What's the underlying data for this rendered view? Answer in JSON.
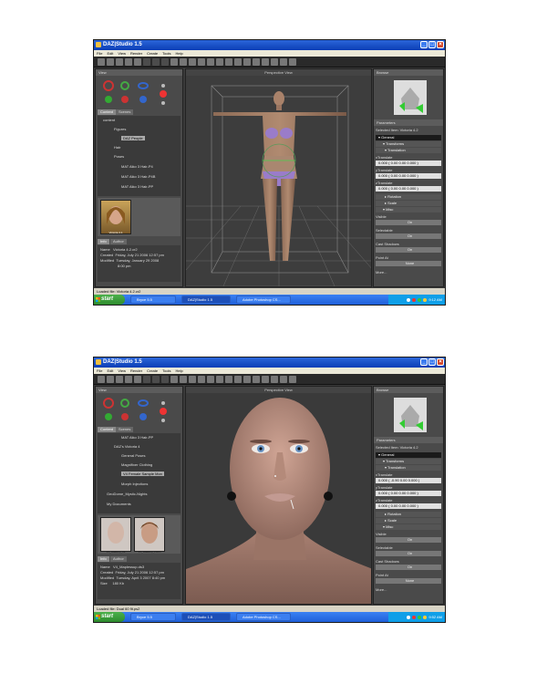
{
  "shot1": {
    "window_title": "DAZ|Studio 1.5",
    "menu": [
      "File",
      "Edit",
      "View",
      "Render",
      "Create",
      "Tools",
      "Help"
    ],
    "view_panel_title": "View",
    "content_tabs": [
      "Content",
      "Scenes"
    ],
    "tree": [
      "content",
      "Figures",
      "DAZ People",
      "Hair",
      "Poses",
      "MAT Aiko 3 Hair-P4",
      "MAT Aiko 3 Hair-P4B",
      "MAT Aiko 3 Hair-PP"
    ],
    "tree_selected_index": 2,
    "thumb_label": "Victoria 4.1",
    "info_tabs": [
      "Info",
      "Author"
    ],
    "info_rows": [
      [
        "Name",
        "Victoria 4.2.cr2"
      ],
      [
        "Created",
        "Friday, July 21 2006 12:57 pm"
      ],
      [
        "Modified",
        "Tuesday, January 29 2008"
      ],
      [
        "",
        "8:00 pm"
      ]
    ],
    "viewport_title": "Perspective View",
    "browse_title": "Browse",
    "params_title": "Parameters",
    "selected_item": "Selected Item:  Victoria 4.2",
    "groups": [
      "General",
      "Transforms",
      "Translation"
    ],
    "sliders": [
      {
        "label": "xTranslate",
        "left": "0.000 ( 0.00",
        "right": "0.00 0.000 )"
      },
      {
        "label": "yTranslate",
        "left": "0.000 ( 0.00",
        "right": "0.00 0.000 )"
      },
      {
        "label": "zTranslate",
        "left": "0.000 ( 0.00",
        "right": "0.00 0.000 )"
      }
    ],
    "subgroups": [
      "Rotation",
      "Scale",
      "Misc"
    ],
    "toggles": [
      [
        "Visible",
        "On"
      ],
      [
        "Selectable",
        "On"
      ],
      [
        "Cast Shadows",
        "On"
      ],
      [
        "Point At",
        "None"
      ]
    ],
    "more_label": "More...",
    "status": "Loaded file: Victoria 4.2.cr2",
    "taskbar": {
      "start": "start",
      "tasks": [
        "Bryce 5.5",
        "DAZ|Studio 1.5",
        "Adobe Photoshop CS..."
      ],
      "clock": "9:12 AM",
      "active_task": 1
    }
  },
  "shot2": {
    "window_title": "DAZ|Studio 1.5",
    "menu": [
      "File",
      "Edit",
      "View",
      "Render",
      "Create",
      "Tools",
      "Help"
    ],
    "view_panel_title": "View",
    "content_tabs": [
      "Content",
      "Scenes"
    ],
    "tree": [
      "MAT Aiko 3 Hair-PP",
      "DAZ's Victoria 4",
      "General Poses",
      "Magnifixer Clothing",
      "V4 Female Sample Mon",
      "Morph Injections",
      "GeoDome_Mystic-Nights",
      "My Documents"
    ],
    "tree_selected_index": 4,
    "thumbs": [
      "V4_Makeup_02",
      "V4_Makeup_PB05"
    ],
    "info_tabs": [
      "Info",
      "Author"
    ],
    "info_rows": [
      [
        "Name",
        "V4_Maplessup.ds3"
      ],
      [
        "Created",
        "Friday, July 21 2006 12:57 pm"
      ],
      [
        "Modified",
        "Tuesday, April 3 2007 8:40 pm"
      ],
      [
        "Size",
        "180 Kb"
      ]
    ],
    "viewport_title": "Perspective View",
    "browse_title": "Browse",
    "params_title": "Parameters",
    "selected_item": "Selected Item:  Victoria 4.2",
    "groups": [
      "General",
      "Transforms",
      "Translation"
    ],
    "sliders": [
      {
        "label": "xTranslate",
        "left": "0.000 ( -0.90",
        "right": "0.00 0.000 )"
      },
      {
        "label": "yTranslate",
        "left": "0.000 ( 0.00",
        "right": "0.00 0.000 )"
      },
      {
        "label": "zTranslate",
        "left": "0.000 ( 0.00",
        "right": "0.00 0.000 )"
      }
    ],
    "subgroups": [
      "Rotation",
      "Scale",
      "Misc"
    ],
    "toggles": [
      [
        "Visible",
        "On"
      ],
      [
        "Selectable",
        "On"
      ],
      [
        "Cast Shadows",
        "On"
      ],
      [
        "Point At",
        "None"
      ]
    ],
    "more_label": "More...",
    "status": "Loaded file: Dual 60 fit.ps2",
    "taskbar": {
      "start": "start",
      "tasks": [
        "Bryce 5.5",
        "DAZ|Studio 1.5",
        "Adobe Photoshop CS..."
      ],
      "clock": "9:52 AM",
      "active_task": 1
    }
  }
}
